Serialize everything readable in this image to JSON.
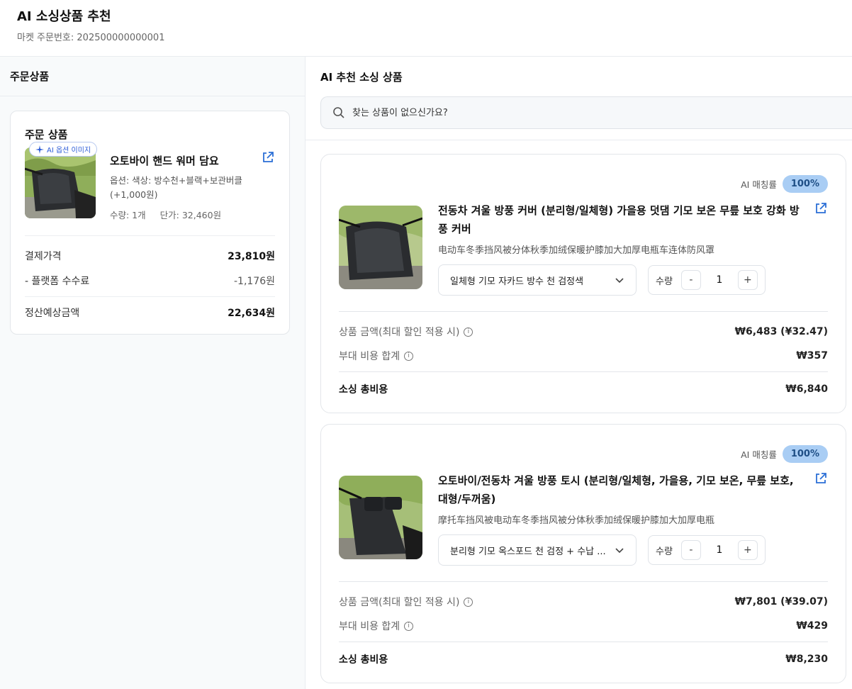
{
  "header": {
    "title": "AI 소싱상품 추천",
    "order_no_label": "마켓 주문번호: 202500000000001"
  },
  "left": {
    "panel_title": "주문상품",
    "card": {
      "title": "주문 상품",
      "ai_chip": "AI 옵션 이미지",
      "product_name": "오토바이 핸드 워머 담요",
      "option": "옵션: 색상: 방수천+블랙+보관버클 (+1,000원)",
      "quantity": "수량: 1개",
      "unit_price": "단가: 32,460원",
      "payment_label": "결제가격",
      "payment_value": "23,810원",
      "fee_label": "- 플랫폼 수수료",
      "fee_value": "-1,176원",
      "settle_label": "정산예상금액",
      "settle_value": "22,634원"
    }
  },
  "right": {
    "panel_title": "AI 추천 소싱 상품",
    "search": {
      "placeholder": "찾는 상품이 없으신가요?"
    },
    "results": [
      {
        "match_label": "AI 매칭률",
        "match_value": "100%",
        "name": "전동차 겨울 방풍 커버 (분리형/일체형) 가을용 덧댐 기모 보온 무릎 보호 강화 방풍 커버",
        "subtitle": "电动车冬季挡风被分体秋季加绒保暖护膝加大加厚电瓶车连体防风罩",
        "option_selected": "일체형 기모 자카드 방수 천 검정색",
        "qty_label": "수량",
        "qty_value": "1",
        "price_label": "상품 금액(최대 할인 적용 시)",
        "price_value": "₩6,483 (¥32.47)",
        "extra_label": "부대 비용 합계",
        "extra_value": "₩357",
        "total_label": "소싱 총비용",
        "total_value": "₩6,840"
      },
      {
        "match_label": "AI 매칭률",
        "match_value": "100%",
        "name": "오토바이/전동차 겨울 방풍 토시 (분리형/일체형, 가을용, 기모 보온, 무릎 보호, 대형/두꺼움)",
        "subtitle": "摩托车挡风被电动车冬季挡风被分体秋季加绒保暖护膝加大加厚电瓶",
        "option_selected": "분리형 기모 옥스포드 천 검정 + 수납 ...",
        "qty_label": "수량",
        "qty_value": "1",
        "price_label": "상품 금액(최대 할인 적용 시)",
        "price_value": "₩7,801 (¥39.07)",
        "extra_label": "부대 비용 합계",
        "extra_value": "₩429",
        "total_label": "소싱 총비용",
        "total_value": "₩8,230"
      }
    ]
  },
  "colors": {
    "accent": "#2b6fd6",
    "badge_bg": "#a9cdf4"
  }
}
